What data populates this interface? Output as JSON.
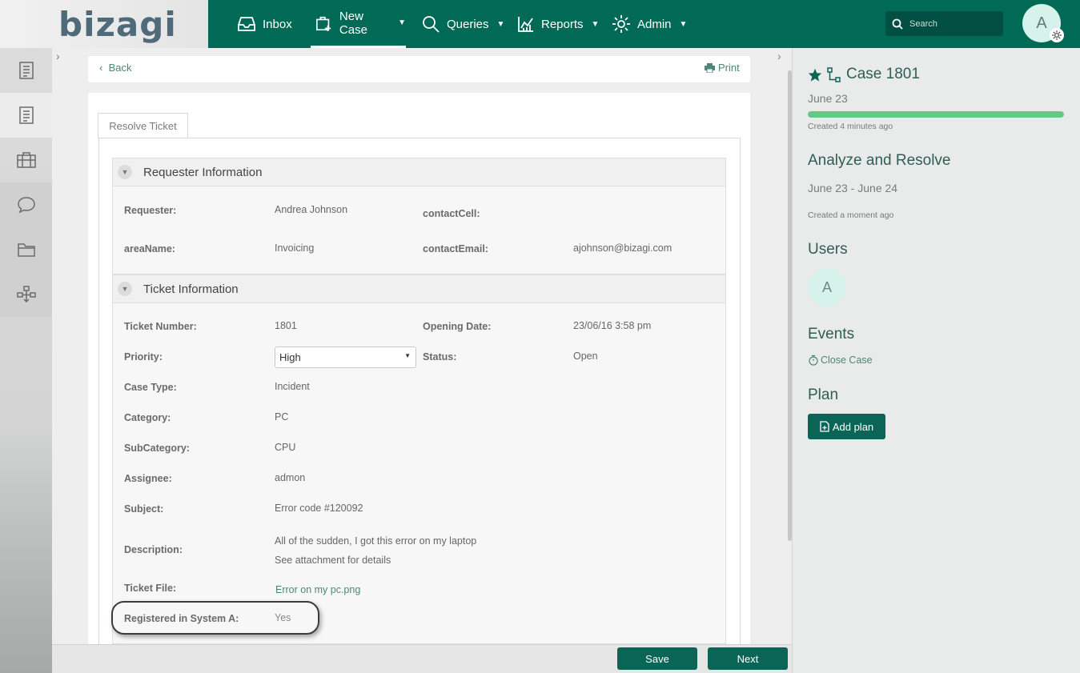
{
  "brand": {
    "logo_text": "bizagi",
    "accent": "#006a57",
    "button_color": "#0a6556"
  },
  "nav": {
    "inbox": "Inbox",
    "new_case": "New Case",
    "queries": "Queries",
    "reports": "Reports",
    "admin": "Admin"
  },
  "search": {
    "placeholder": "Search"
  },
  "user": {
    "initial": "A"
  },
  "toolbar": {
    "back": "Back",
    "print": "Print"
  },
  "form": {
    "tab": "Resolve Ticket",
    "requester_group": {
      "title": "Requester Information",
      "requester_label": "Requester:",
      "requester_value": "Andrea Johnson",
      "contact_cell_label": "contactCell:",
      "area_label": "areaName:",
      "area_value": "Invoicing",
      "contact_email_label": "contactEmail:",
      "contact_email_value": "ajohnson@bizagi.com"
    },
    "ticket_group": {
      "title": "Ticket Information",
      "ticket_number_label": "Ticket Number:",
      "ticket_number_value": "1801",
      "opening_date_label": "Opening Date:",
      "opening_date_value": "23/06/16 3:58 pm",
      "priority_label": "Priority:",
      "priority_value": "High",
      "status_label": "Status:",
      "status_value": "Open",
      "case_type_label": "Case Type:",
      "case_type_value": "Incident",
      "category_label": "Category:",
      "category_value": "PC",
      "subcategory_label": "SubCategory:",
      "subcategory_value": "CPU",
      "assignee_label": "Assignee:",
      "assignee_value": "admon",
      "subject_label": "Subject:",
      "subject_value": "Error code #120092",
      "description_label": "Description:",
      "description_line1": "All of the sudden, I got this error on my laptop",
      "description_line2": "See attachment for details",
      "ticket_file_label": "Ticket File:",
      "ticket_file_value": "Error on my pc.png",
      "registered_label": "Registered in System A:",
      "registered_value": "Yes"
    }
  },
  "side": {
    "case_title": "Case 1801",
    "case_date": "June 23",
    "progress": 1.0,
    "case_created": "Created 4 minutes ago",
    "task_title": "Analyze and Resolve",
    "task_dates": "June 23 - June 24",
    "task_created": "Created a moment ago",
    "users_heading": "Users",
    "user_initial": "A",
    "events_heading": "Events",
    "close_case": "Close Case",
    "plan_heading": "Plan",
    "add_plan": "Add plan"
  },
  "footer": {
    "save": "Save",
    "next": "Next"
  }
}
